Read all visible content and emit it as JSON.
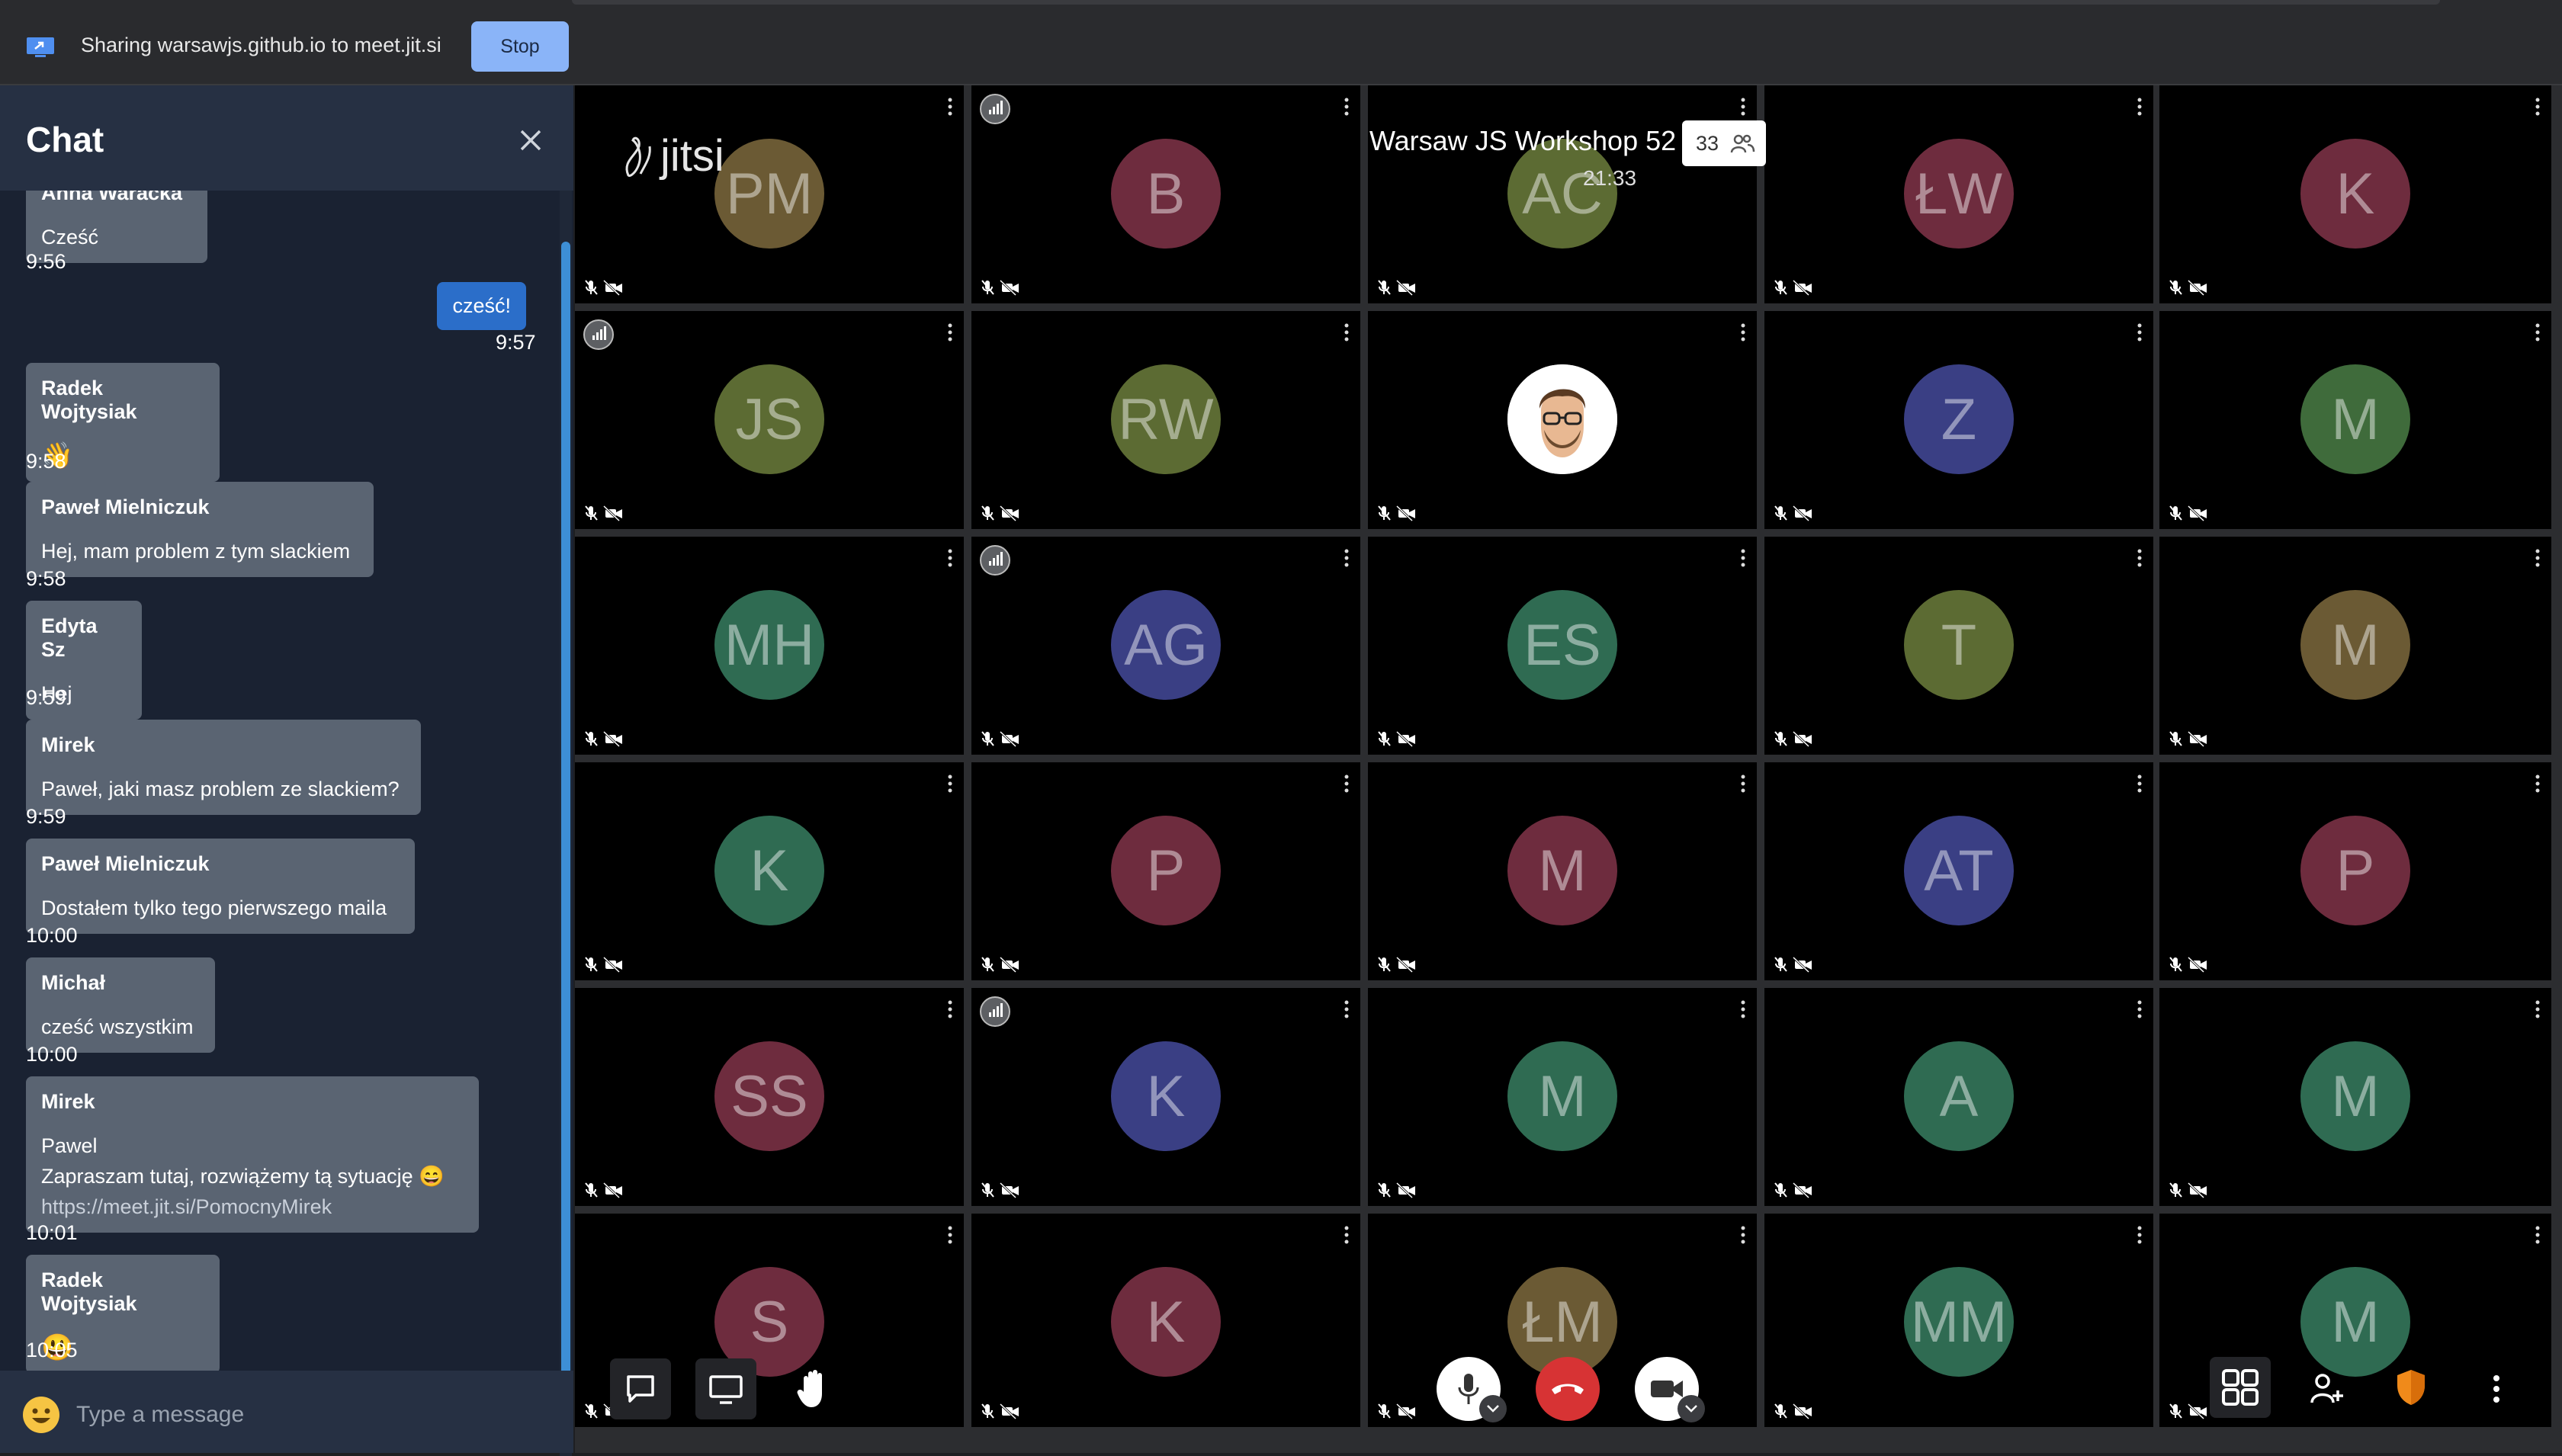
{
  "share_bar": {
    "text": "Sharing warsawjs.github.io to meet.jit.si",
    "stop_label": "Stop"
  },
  "chat": {
    "title": "Chat",
    "input_placeholder": "Type a message",
    "partial_first": {
      "sender": "Anna Waracka",
      "text": "Cześć",
      "time": "9:56"
    },
    "own_message": {
      "text": "cześć!",
      "time": "9:57"
    },
    "messages": [
      {
        "sender": "Radek Wojtysiak",
        "text": "👋",
        "time": "9:58"
      },
      {
        "sender": "Paweł Mielniczuk",
        "text": "Hej, mam problem z tym slackiem",
        "time": "9:58"
      },
      {
        "sender": "Edyta Sz",
        "text": "Hej",
        "time": "9:59"
      },
      {
        "sender": "Mirek",
        "text": "Paweł, jaki masz problem ze slackiem?",
        "time": "9:59"
      },
      {
        "sender": "Paweł Mielniczuk",
        "text": "Dostałem tylko tego pierwszego maila",
        "time": "10:00"
      },
      {
        "sender": "Michał",
        "text": "cześć wszystkim",
        "time": "10:00"
      },
      {
        "sender": "Mirek",
        "line1": "Pawel",
        "line2": "Zapraszam tutaj, rozwiążemy tą sytuację 😄",
        "link": "https://meet.jit.si/PomocnyMirek",
        "time": "10:01"
      },
      {
        "sender": "Radek Wojtysiak",
        "text": "😃",
        "time": "10:05"
      }
    ]
  },
  "meeting": {
    "logo": "jitsi",
    "title": "Warsaw JS Workshop 52",
    "timer": "21:33",
    "participant_count": "33"
  },
  "tiles": [
    [
      "PM",
      "B",
      "AC",
      "ŁW",
      "K"
    ],
    [
      "JS",
      "RW",
      "",
      "Z",
      "M"
    ],
    [
      "MH",
      "AG",
      "ES",
      "T",
      "M"
    ],
    [
      "K",
      "P",
      "M",
      "AT",
      "P"
    ],
    [
      "SS",
      "K",
      "M",
      "A",
      "M"
    ],
    [
      "S",
      "K",
      "ŁM",
      "MM",
      "M"
    ]
  ],
  "tile_colors": [
    [
      "#6b5a34",
      "#6e2c3e",
      "#5c6b33",
      "#6e2c3e",
      "#6e2c3e"
    ],
    [
      "#5c6b33",
      "#5c6b33",
      "#ffffff",
      "#3a3f84",
      "#3f6b3b"
    ],
    [
      "#2f6b52",
      "#3a3f84",
      "#2f6b52",
      "#5c6b33",
      "#6b5a34"
    ],
    [
      "#2f6b52",
      "#6e2c3e",
      "#6e2c3e",
      "#3a3f84",
      "#6e2c3e"
    ],
    [
      "#6e2c3e",
      "#3a3f84",
      "#2f6b52",
      "#2f6b52",
      "#2f6b52"
    ],
    [
      "#6e2c3e",
      "#6e2c3e",
      "#6b5a34",
      "#2f6b52",
      "#2f6b52"
    ]
  ],
  "icons": {
    "share": "screen-share-icon",
    "close": "close-icon",
    "emoji": "smile-icon",
    "chat": "chat-icon",
    "screen": "screen-share-icon",
    "hand": "raise-hand-icon",
    "mic": "microphone-icon",
    "hangup": "hangup-icon",
    "camera": "camera-icon",
    "tileview": "tile-view-icon",
    "invite": "invite-icon",
    "security": "shield-icon",
    "more": "more-icon"
  }
}
